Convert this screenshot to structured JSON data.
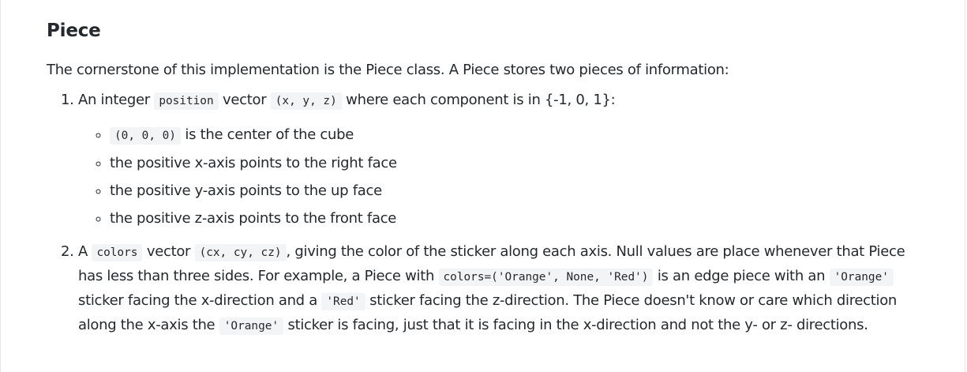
{
  "section": {
    "heading": "Piece",
    "intro": "The cornerstone of this implementation is the Piece class. A Piece stores two pieces of information:"
  },
  "items": [
    {
      "marker": "1.",
      "text_before": "An integer",
      "code_1": "position",
      "text_middle": "vector",
      "code_2": "(x, y, z)",
      "text_after": "where each component is in {-1, 0, 1}:",
      "subitems": [
        {
          "code": "(0, 0, 0)",
          "text": "is the center of the cube"
        },
        {
          "text": "the positive x-axis points to the right face"
        },
        {
          "text": "the positive y-axis points to the up face"
        },
        {
          "text": "the positive z-axis points to the front face"
        }
      ]
    },
    {
      "marker": "2.",
      "text_before": "A",
      "code_1": "colors",
      "text_middle": "vector",
      "code_2": "(cx, cy, cz)",
      "text_a": ", giving the color of the sticker along each axis. Null values are place whenever that Piece has less than three sides. For example, a Piece with",
      "code_3": "colors=('Orange', None, 'Red')",
      "text_b": "is an edge piece with an",
      "code_4": "'Orange'",
      "text_c": "sticker facing the x-direction and a",
      "code_5": "'Red'",
      "text_d": "sticker facing the z-direction. The Piece doesn't know or care which direction along the x-axis the",
      "code_6": "'Orange'",
      "text_e": "sticker is facing, just that it is facing in the x-direction and not the y- or z- directions."
    }
  ]
}
